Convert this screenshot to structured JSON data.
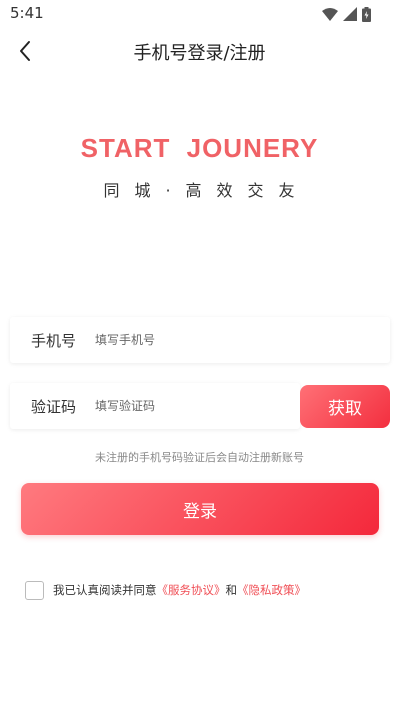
{
  "status_bar": {
    "time": "5:41",
    "icons": [
      "wifi-icon",
      "signal-icon",
      "battery-icon"
    ]
  },
  "nav": {
    "title": "手机号登录/注册",
    "back_icon": "chevron-left-icon"
  },
  "brand": {
    "title": "START JOUNERY",
    "subtitle": "同城·高效交友",
    "color": "#f06266"
  },
  "form": {
    "phone_label": "手机号",
    "phone_placeholder": "填写手机号",
    "phone_value": "",
    "code_label": "验证码",
    "code_placeholder": "填写验证码",
    "code_value": "",
    "get_code_label": "获取",
    "hint": "未注册的手机号码验证后会自动注册新账号",
    "login_label": "登录"
  },
  "agreement": {
    "checked": false,
    "prefix": "我已认真阅读并同意",
    "service_link": "《服务协议》",
    "connector": "和",
    "privacy_link": "《隐私政策》"
  },
  "colors": {
    "accent": "#f04e55",
    "gradient_start": "#ff7a7f",
    "gradient_end": "#f4283b"
  }
}
